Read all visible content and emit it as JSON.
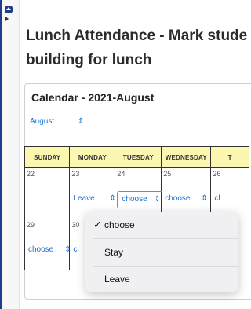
{
  "page": {
    "title_line1": "Lunch Attendance - Mark stude",
    "title_line2": "building for lunch"
  },
  "calendar": {
    "heading": "Calendar - 2021-August",
    "month_select": {
      "value": "August",
      "chevron": "⇕"
    },
    "weekdays": [
      "Sunday",
      "Monday",
      "Tuesday",
      "Wednesday",
      "T"
    ],
    "weeks": [
      [
        {
          "day": "22",
          "choice": ""
        },
        {
          "day": "23",
          "choice": "Leave"
        },
        {
          "day": "24",
          "choice": "choose"
        },
        {
          "day": "25",
          "choice": "choose"
        },
        {
          "day": "26",
          "choice": "cl"
        }
      ],
      [
        {
          "day": "29",
          "choice": "choose"
        },
        {
          "day": "30",
          "choice": "c"
        },
        {
          "day": "",
          "choice": ""
        },
        {
          "day": "",
          "choice": ""
        },
        {
          "day": "",
          "choice": ""
        }
      ]
    ]
  },
  "dropdown": {
    "options": [
      {
        "label": "choose",
        "checked": "✓"
      },
      {
        "label": "Stay",
        "checked": ""
      },
      {
        "label": "Leave",
        "checked": ""
      }
    ]
  },
  "icons": {
    "collapse": "triangle-up-icon",
    "expand": "triangle-right-icon",
    "chevron": "updown-chevron-icon"
  },
  "colors": {
    "header_bg": "#fbf6b0",
    "link_blue": "#1a6fd0",
    "accent": "#1f3c88"
  }
}
